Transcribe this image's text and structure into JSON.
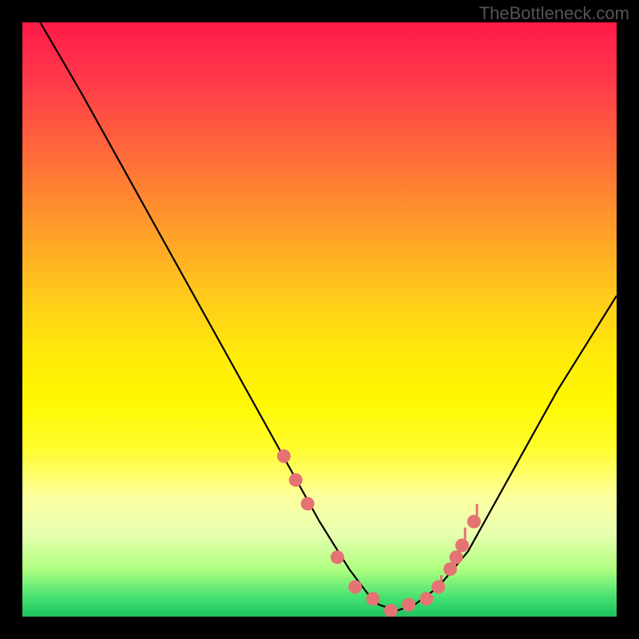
{
  "watermark": "TheBottleneck.com",
  "chart_data": {
    "type": "line",
    "title": "",
    "xlabel": "",
    "ylabel": "",
    "xlim": [
      0,
      100
    ],
    "ylim": [
      0,
      100
    ],
    "series": [
      {
        "name": "curve",
        "x": [
          3,
          10,
          20,
          30,
          40,
          45,
          50,
          55,
          58,
          60,
          63,
          66,
          70,
          75,
          80,
          85,
          90,
          95,
          100
        ],
        "y": [
          100,
          88,
          70,
          52,
          34,
          25,
          16,
          8,
          4,
          2,
          1,
          2,
          5,
          11,
          20,
          29,
          38,
          46,
          54
        ]
      }
    ],
    "markers": {
      "name": "dots",
      "color": "#e57373",
      "x": [
        44,
        46,
        48,
        53,
        56,
        59,
        62,
        65,
        68,
        70,
        72,
        73,
        74,
        76
      ],
      "y": [
        27,
        23,
        19,
        10,
        5,
        3,
        1,
        2,
        3,
        5,
        8,
        10,
        12,
        16
      ]
    },
    "ticks": {
      "color": "#e57373",
      "x": [
        70.5,
        71.5,
        72.5,
        73.5,
        74.5,
        75.5,
        76.5
      ],
      "y_base": [
        6,
        8,
        10,
        12,
        14,
        16,
        18
      ]
    }
  }
}
